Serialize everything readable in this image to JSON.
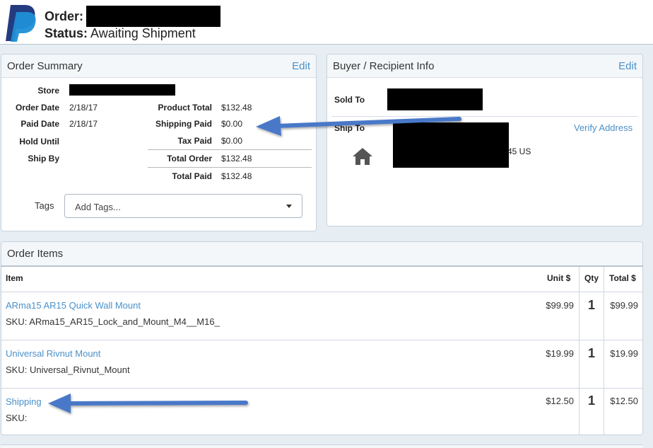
{
  "header": {
    "order_label": "Order:",
    "status_label": "Status:",
    "status_value": "Awaiting Shipment",
    "logo": "paypal-logo"
  },
  "order_summary": {
    "title": "Order Summary",
    "edit": "Edit",
    "store_label": "Store",
    "order_date_label": "Order Date",
    "order_date": "2/18/17",
    "paid_date_label": "Paid Date",
    "paid_date": "2/18/17",
    "hold_until_label": "Hold Until",
    "ship_by_label": "Ship By",
    "product_total_label": "Product Total",
    "product_total": "$132.48",
    "shipping_paid_label": "Shipping Paid",
    "shipping_paid": "$0.00",
    "tax_paid_label": "Tax Paid",
    "tax_paid": "$0.00",
    "total_order_label": "Total Order",
    "total_order": "$132.48",
    "total_paid_label": "Total Paid",
    "total_paid": "$132.48",
    "tags_label": "Tags",
    "tags_placeholder": "Add Tags..."
  },
  "buyer": {
    "title": "Buyer / Recipient Info",
    "edit": "Edit",
    "sold_to_label": "Sold To",
    "ship_to_label": "Ship To",
    "verify_address": "Verify Address",
    "address_tail": "45 US",
    "icon": "house-icon"
  },
  "items": {
    "title": "Order Items",
    "columns": {
      "item": "Item",
      "unit": "Unit $",
      "qty": "Qty",
      "total": "Total $"
    },
    "rows": [
      {
        "name": "ARma15 AR15 Quick Wall Mount",
        "sku": "SKU: ARma15_AR15_Lock_and_Mount_M4__M16_",
        "unit": "$99.99",
        "qty": "1",
        "total": "$99.99"
      },
      {
        "name": "Universal Rivnut Mount",
        "sku": "SKU: Universal_Rivnut_Mount",
        "unit": "$19.99",
        "qty": "1",
        "total": "$19.99"
      },
      {
        "name": "Shipping",
        "sku": "SKU:",
        "unit": "$12.50",
        "qty": "1",
        "total": "$12.50"
      }
    ]
  },
  "colors": {
    "link": "#4a90c9",
    "arrow": "#4a78c8",
    "background": "#e6edf3"
  }
}
